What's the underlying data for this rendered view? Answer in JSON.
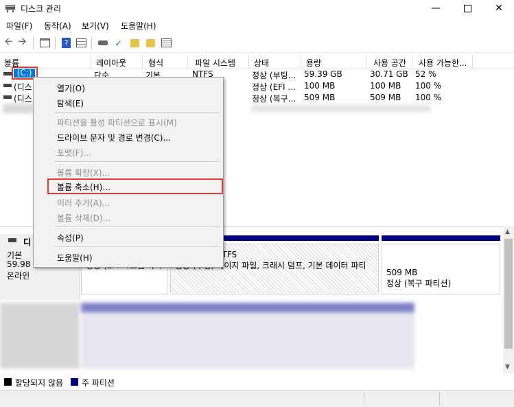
{
  "window": {
    "title": "디스크 관리",
    "minimize_icon": "minimize-icon",
    "maximize_icon": "maximize-icon",
    "close_icon": "close-icon"
  },
  "menubar": [
    "파일(F)",
    "동작(A)",
    "보기(V)",
    "도움말(H)"
  ],
  "columns": [
    "볼륨",
    "레이아웃",
    "형식",
    "파일 시스템",
    "상태",
    "용량",
    "사용 공간",
    "사용 가능한..."
  ],
  "volumes": [
    {
      "name": "(C:)",
      "layout": "단순",
      "type": "기본",
      "fs": "NTFS",
      "status": "정상 (부팅...",
      "capacity": "59.39 GB",
      "free": "30.71 GB",
      "pct": "52 %"
    },
    {
      "name": "(디스",
      "status": "정상 (EFI ...",
      "capacity": "100 MB",
      "free": "100 MB",
      "pct": "100 %"
    },
    {
      "name": "(디스",
      "status": "정상 (복구...",
      "capacity": "509 MB",
      "free": "509 MB",
      "pct": "100 %"
    }
  ],
  "context_menu": {
    "open": "열기(O)",
    "explore": "탐색(E)",
    "mark_active": "파티션을 활성 파티션으로 표시(M)",
    "change_letter": "드라이브 문자 및 경로 변경(C)...",
    "format": "포맷(F)...",
    "extend": "볼륨 확장(X)...",
    "shrink": "볼륨 축소(H)...",
    "add_mirror": "미러 추가(A)...",
    "delete": "볼륨 삭제(D)...",
    "properties": "속성(P)",
    "help": "도움말(H)"
  },
  "disk": {
    "label": "디",
    "type": "기본",
    "size": "59.98 G",
    "state": "온라인",
    "partitions": [
      {
        "size": "",
        "status": "정상 (EFI 시스템 파티"
      },
      {
        "size": "59.39 GB NTFS",
        "status": "정상 (부팅, 페이지 파일, 크래시 덤프, 기본 데이터 파티"
      },
      {
        "size": "509 MB",
        "status": "정상 (복구 파티션)"
      }
    ]
  },
  "legend": {
    "unallocated": "할당되지 않음",
    "primary": "주 파티션",
    "unallocated_color": "#000000",
    "primary_color": "#00007f"
  },
  "accent": {
    "selection": "#0078d7",
    "highlight_box": "#e53935"
  }
}
